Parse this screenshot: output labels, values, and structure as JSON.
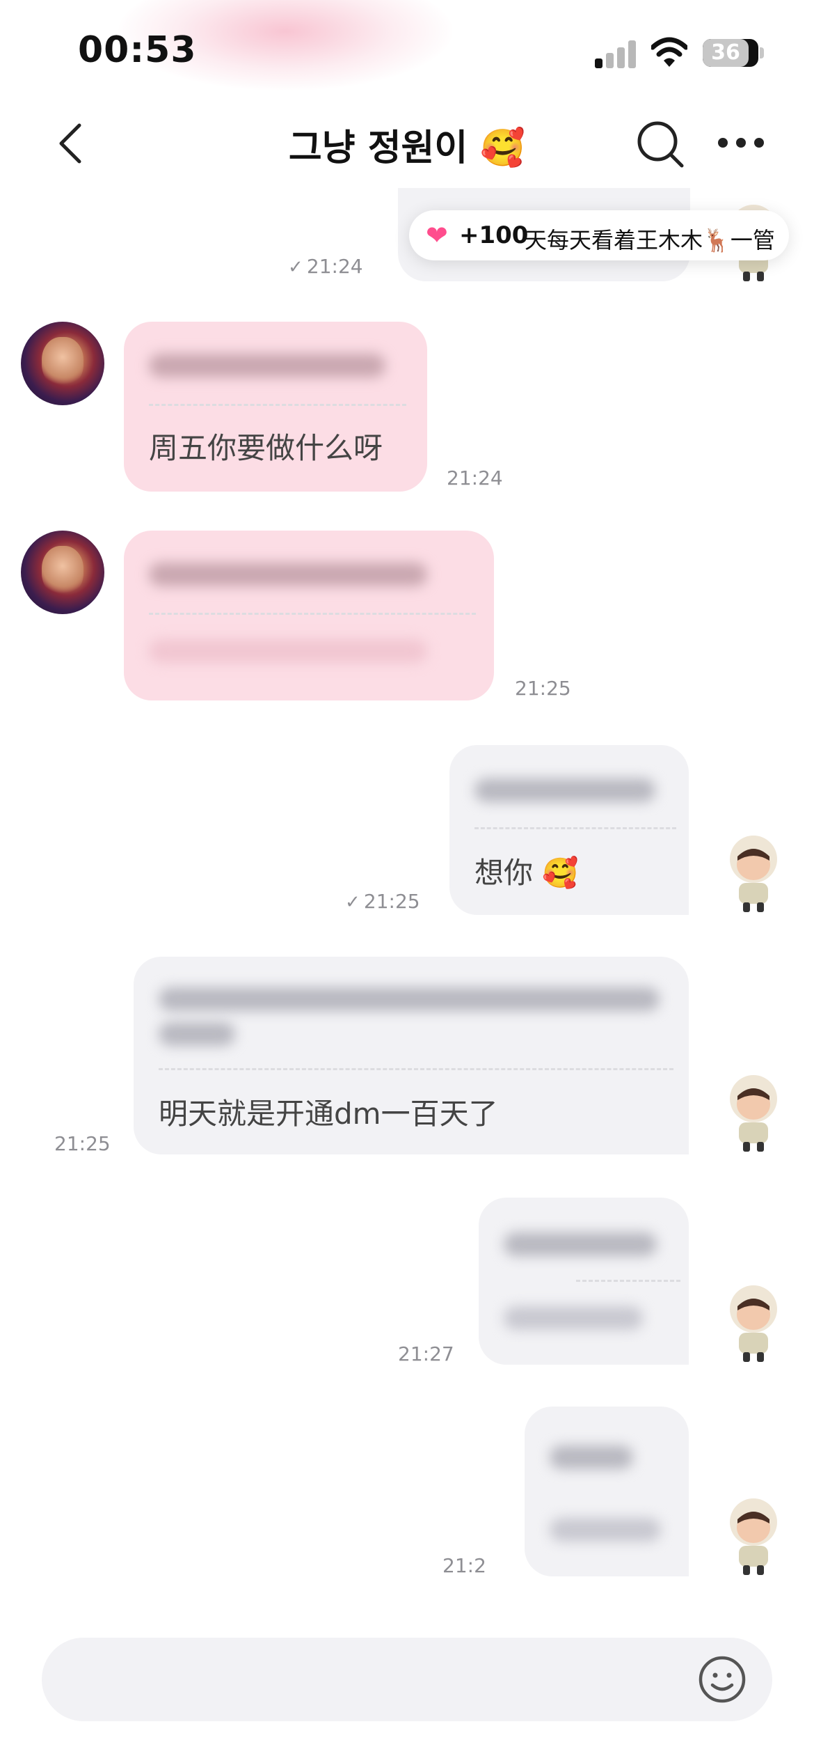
{
  "status_bar": {
    "time": "00:53",
    "battery": "36"
  },
  "header": {
    "title": "그냥 정원이 🥰"
  },
  "banner": {
    "heart": "❤",
    "count": "+100",
    "text": "天每天看着王木木🦌一管"
  },
  "messages": [
    {
      "side": "right",
      "translation": "",
      "time": "21:24",
      "read_check": "✓"
    },
    {
      "side": "left",
      "translation": "周五你要做什么呀",
      "time": "21:24"
    },
    {
      "side": "left",
      "translation": "",
      "time": "21:25"
    },
    {
      "side": "right",
      "translation": "想你 🥰",
      "time": "21:25",
      "read_check": "✓"
    },
    {
      "side": "right",
      "translation": "明天就是开通dm一百天了",
      "time": "21:25"
    },
    {
      "side": "right",
      "translation": "",
      "time": "21:27"
    },
    {
      "side": "right",
      "translation": "",
      "time": "21:2"
    }
  ],
  "composer": {
    "placeholder": ""
  },
  "icons": [
    "back-icon",
    "search-icon",
    "more-icon",
    "smiley-icon",
    "signal-icon",
    "wifi-icon",
    "battery-icon"
  ]
}
